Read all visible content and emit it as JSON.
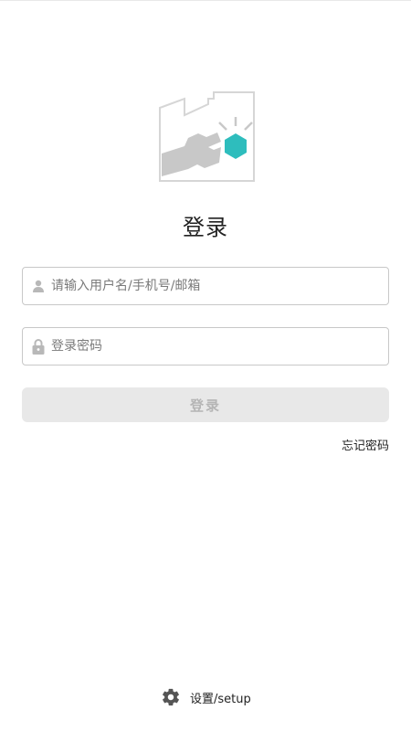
{
  "header": {
    "title": "登录"
  },
  "form": {
    "username": {
      "placeholder": "请输入用户名/手机号/邮箱",
      "value": "",
      "icon": "user-icon"
    },
    "password": {
      "placeholder": "登录密码",
      "value": "",
      "icon": "lock-icon"
    },
    "login_button": "登录",
    "forgot_link": "忘记密码"
  },
  "footer": {
    "setup_label": "设置/setup",
    "icon": "gear-icon"
  },
  "colors": {
    "accent": "#2ebdbd",
    "logo_gray": "#c8c8c8",
    "button_bg": "#e8e8e8",
    "button_text": "#b5b5b5"
  }
}
